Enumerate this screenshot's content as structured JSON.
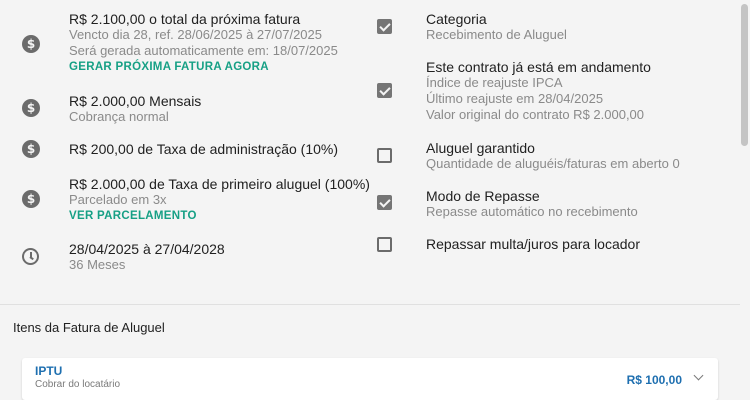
{
  "left": {
    "next_invoice": {
      "title": "R$ 2.100,00 o total da próxima fatura",
      "due": "Vencto dia 28, ref. 28/06/2025 à 27/07/2025",
      "auto": "Será gerada automaticamente em: 18/07/2025",
      "action": "GERAR PRÓXIMA FATURA AGORA"
    },
    "monthly": {
      "title": "R$ 2.000,00 Mensais",
      "sub": "Cobrança normal"
    },
    "admin_fee": {
      "title": "R$ 200,00 de Taxa de administração (10%)"
    },
    "first_rent_fee": {
      "title": "R$ 2.000,00 de Taxa de primeiro aluguel (100%)",
      "sub": "Parcelado em 3x",
      "action": "VER PARCELAMENTO"
    },
    "period": {
      "title": "28/04/2025 à 27/04/2028",
      "sub": "36 Meses"
    }
  },
  "right": {
    "category": {
      "title": "Categoria",
      "sub": "Recebimento de Aluguel",
      "checked": true
    },
    "ongoing": {
      "title": "Este contrato já está em andamento",
      "line1": "Índice de reajuste IPCA",
      "line2": "Último reajuste em 28/04/2025",
      "line3": "Valor original do contrato R$ 2.000,00",
      "checked": true
    },
    "guaranteed": {
      "title": "Aluguel garantido",
      "sub": "Quantidade de aluguéis/faturas em aberto 0",
      "checked": false
    },
    "transfer": {
      "title": "Modo de Repasse",
      "sub": "Repasse automático no recebimento",
      "checked": true
    },
    "pass_fines": {
      "title": "Repassar multa/juros para locador",
      "checked": false
    }
  },
  "invoice_items": {
    "title": "Itens da Fatura de Aluguel",
    "items": [
      {
        "name": "IPTU",
        "sub": "Cobrar do locatário",
        "value": "R$ 100,00"
      }
    ]
  },
  "icons": {
    "money": "dollar-coin-icon",
    "clock": "clock-icon",
    "chevron": "chevron-down-icon"
  },
  "colors": {
    "link": "#16a085",
    "accent": "#1e6fb0"
  }
}
